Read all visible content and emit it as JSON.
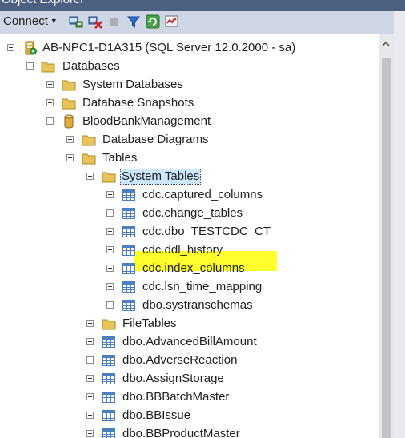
{
  "window": {
    "title": "Object Explorer"
  },
  "toolbar": {
    "connect_label": "Connect",
    "icons": [
      "connect-object-explorer-icon",
      "disconnect-icon",
      "stop-icon",
      "filter-icon",
      "refresh-icon",
      "activity-monitor-icon"
    ]
  },
  "tree": {
    "server": "AB-NPC1-D1A315 (SQL Server 12.0.2000 - sa)",
    "databases": "Databases",
    "system_databases": "System Databases",
    "database_snapshots": "Database Snapshots",
    "db_name": "BloodBankManagement",
    "database_diagrams": "Database Diagrams",
    "tables": "Tables",
    "system_tables": "System Tables",
    "system_table_items": [
      "cdc.captured_columns",
      "cdc.change_tables",
      "cdc.dbo_TESTCDC_CT",
      "cdc.ddl_history",
      "cdc.index_columns",
      "cdc.lsn_time_mapping",
      "dbo.systranschemas"
    ],
    "file_tables": "FileTables",
    "user_tables": [
      "dbo.AdvancedBillAmount",
      "dbo.AdverseReaction",
      "dbo.AssignStorage",
      "dbo.BBBatchMaster",
      "dbo.BBIssue",
      "dbo.BBProductMaster"
    ]
  },
  "colors": {
    "title_bar": "#4d6082",
    "toolbar_bg": "#cfd6e5",
    "highlight": "#ffff2e",
    "selection": "#cce8ff",
    "folder": "#e8c35a",
    "table_icon": "#4a7fc0"
  }
}
